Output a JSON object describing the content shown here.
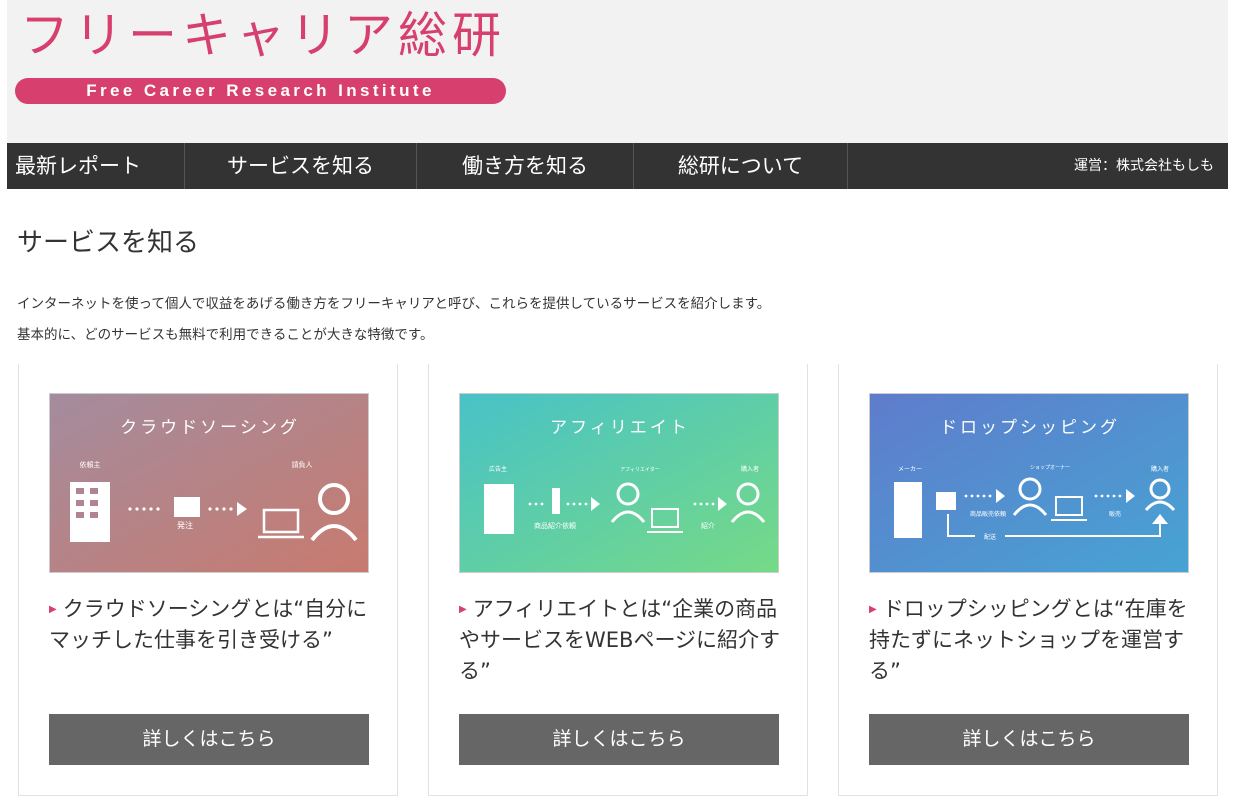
{
  "header": {
    "logo_title": "フリーキャリア総研",
    "logo_subtitle": "Free Career Research Institute",
    "brand_color": "#d63f6e"
  },
  "nav": {
    "items": [
      {
        "label": "最新レポート"
      },
      {
        "label": "サービスを知る"
      },
      {
        "label": "働き方を知る"
      },
      {
        "label": "総研について"
      }
    ],
    "operator": "運営：株式会社もしも"
  },
  "main": {
    "title": "サービスを知る",
    "intro_lines": [
      "インターネットを使って個人で収益をあげる働き方をフリーキャリアと呼び、これらを提供しているサービスを紹介します。",
      "基本的に、どのサービスも無料で利用できることが大きな特徴です。"
    ]
  },
  "cards": [
    {
      "image": {
        "title": "クラウドソーシング",
        "labels": [
          "依頼主",
          "発注",
          "請負人"
        ],
        "colors": [
          "#a68b9c",
          "#c47c72"
        ]
      },
      "text": "クラウドソーシングとは“自分にマッチした仕事を引き受ける”",
      "button": "詳しくはこちら"
    },
    {
      "image": {
        "title": "アフィリエイト",
        "labels": [
          "広告主",
          "商品紹介依頼",
          "アフィリエイター",
          "紹介",
          "購入者"
        ],
        "colors": [
          "#4cc2c4",
          "#72d98a"
        ]
      },
      "text": "アフィリエイトとは“企業の商品やサービスをWEBページに紹介する”",
      "button": "詳しくはこちら"
    },
    {
      "image": {
        "title": "ドロップシッピング",
        "labels": [
          "メーカー",
          "商品販売依頼",
          "ショップオーナー",
          "販売",
          "購入者",
          "配送"
        ],
        "colors": [
          "#5d7fcd",
          "#4a9fd2"
        ]
      },
      "text": "ドロップシッピングとは“在庫を持たずにネットショップを運営する”",
      "button": "詳しくはこちら"
    }
  ]
}
